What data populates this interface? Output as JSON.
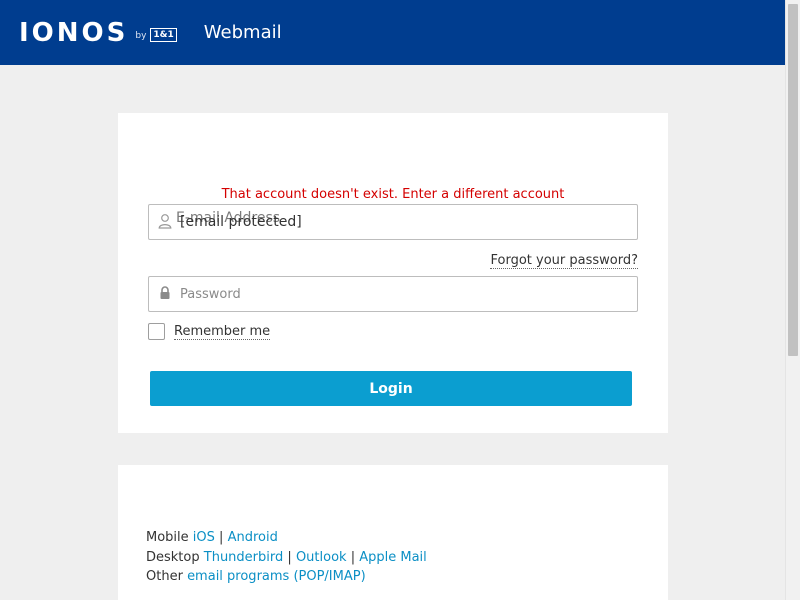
{
  "header": {
    "brand": "IONOS",
    "by": "by",
    "partner": "1&1",
    "app_title": "Webmail",
    "background_color": "#003d8f"
  },
  "login": {
    "error_message": "That account doesn't exist. Enter a different account",
    "email": {
      "label": "E-mail Address",
      "value": "[email protected]",
      "icon": "user-icon"
    },
    "forgot_password": "Forgot your password?",
    "password": {
      "placeholder": "Password",
      "icon": "lock-icon"
    },
    "remember_me": "Remember me",
    "remember_checked": false,
    "login_button": "Login",
    "button_color": "#0b9ed0",
    "error_color": "#d40000"
  },
  "apps": {
    "mobile": {
      "label": "Mobile",
      "links": [
        "iOS",
        "Android"
      ]
    },
    "desktop": {
      "label": "Desktop",
      "links": [
        "Thunderbird",
        "Outlook",
        "Apple Mail"
      ]
    },
    "other": {
      "label": "Other",
      "link": "email programs (POP/IMAP)"
    },
    "separator": "|",
    "link_color": "#0b8fc5"
  }
}
